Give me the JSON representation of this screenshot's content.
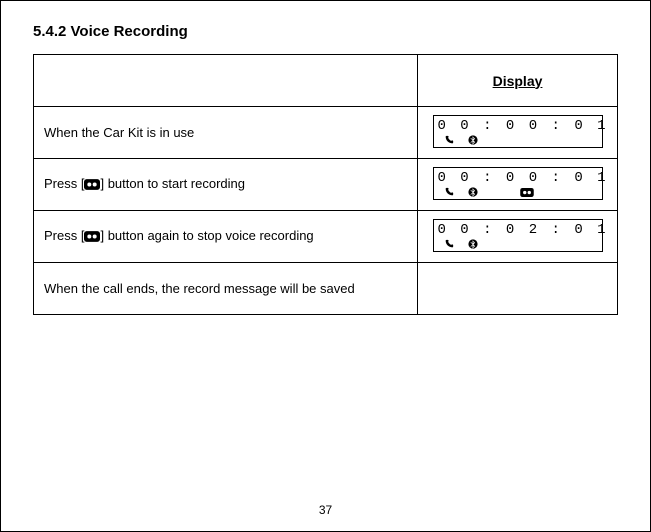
{
  "heading": "5.4.2  Voice Recording",
  "header": {
    "display_label": "Display"
  },
  "rows": [
    {
      "instruction_pre": "When the Car Kit is in use",
      "instruction_post": "",
      "has_btn_icon": false,
      "lcd_time": "0 0 : 0 0 : 0 1",
      "lcd_icons": [
        "phone",
        "bluetooth"
      ]
    },
    {
      "instruction_pre": "Press [",
      "instruction_post": "] button to start recording",
      "has_btn_icon": true,
      "lcd_time": "0 0 : 0 0 : 0 1",
      "lcd_icons": [
        "phone",
        "bluetooth",
        "record"
      ]
    },
    {
      "instruction_pre": "Press  [",
      "instruction_post": "]  button again to stop voice recording",
      "has_btn_icon": true,
      "lcd_time": "0 0 : 0 2 : 0 1",
      "lcd_icons": [
        "phone",
        "bluetooth"
      ]
    },
    {
      "instruction_pre": "When the call ends,  the record message will be saved",
      "instruction_post": "",
      "has_btn_icon": false,
      "lcd_time": null,
      "lcd_icons": []
    }
  ],
  "page_number": "37"
}
